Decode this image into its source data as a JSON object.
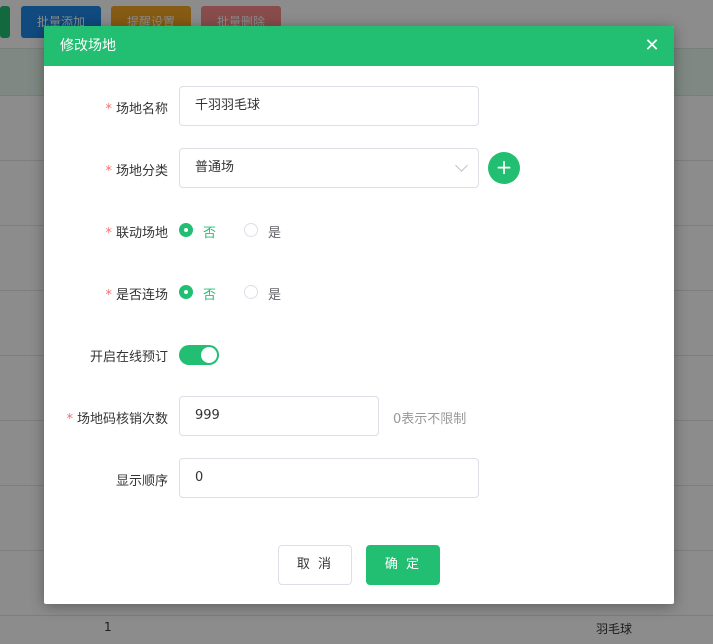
{
  "background": {
    "toolbar": {
      "batch_add": "批量添加",
      "remind_settings": "提醒设置",
      "batch_delete": "批量删除"
    },
    "footer_left": "1",
    "footer_right": "羽毛球"
  },
  "modal": {
    "title": "修改场地",
    "fields": {
      "venue_name": {
        "label": "场地名称",
        "value": "千羽羽毛球",
        "required": true
      },
      "venue_category": {
        "label": "场地分类",
        "value": "普通场",
        "required": true
      },
      "linked_venue": {
        "label": "联动场地",
        "required": true,
        "options": [
          "否",
          "是"
        ],
        "selected": "否"
      },
      "consecutive": {
        "label": "是否连场",
        "required": true,
        "options": [
          "否",
          "是"
        ],
        "selected": "否"
      },
      "online_booking": {
        "label": "开启在线预订",
        "enabled": true
      },
      "verify_count": {
        "label": "场地码核销次数",
        "value": "999",
        "required": true,
        "hint": "0表示不限制"
      },
      "display_order": {
        "label": "显示顺序",
        "value": "0"
      }
    },
    "buttons": {
      "cancel": "取 消",
      "confirm": "确 定"
    }
  },
  "colors": {
    "primary": "#22bf72",
    "required": "#f56c6c"
  }
}
